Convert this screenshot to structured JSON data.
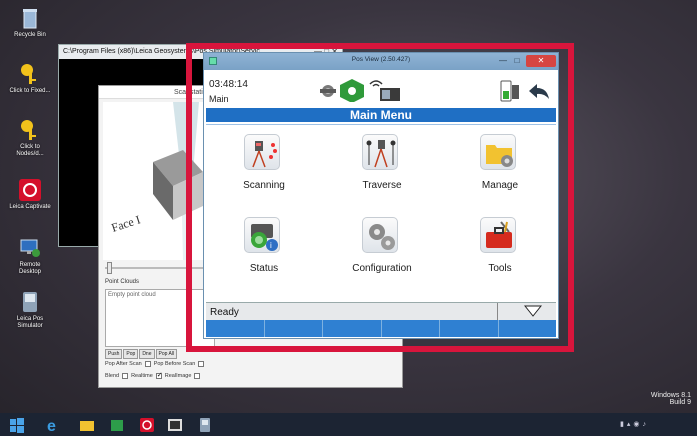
{
  "desktop": {
    "icons": [
      {
        "label": "Recycle Bin"
      },
      {
        "label": "Click to Fixed..."
      },
      {
        "label": "Click to Nodes/d..."
      },
      {
        "label": "Leica Captivate"
      },
      {
        "label": "Remote Desktop"
      },
      {
        "label": "Leica Pos Simulator"
      }
    ],
    "watermark_line1": "Windows 8.1",
    "watermark_line2": "Build 9"
  },
  "console_window": {
    "title": "C:\\Program Files (x86)\\Leica Geosystems\\Pos Simulator\\Servic..."
  },
  "scan_window": {
    "title": "Scanstation",
    "face_label": "Face I",
    "point_clouds_label": "Point Clouds",
    "empty_cloud_text": "Empty point cloud",
    "buttons": [
      "Push",
      "Pop",
      "Dne",
      "Pop All"
    ],
    "options_row1": {
      "pop_after_scan": "Pop After Scan",
      "pop_before_scan": "Pop Before Scan"
    },
    "options_row2": {
      "blend": "Blend",
      "realtime": "Realtime",
      "realimage": "RealImage"
    }
  },
  "pos_view": {
    "window_title": "Pos View (2.50.427)",
    "time": "03:48:14",
    "mode": "Main",
    "menu_title": "Main Menu",
    "tiles": [
      {
        "label": "Scanning"
      },
      {
        "label": "Traverse"
      },
      {
        "label": "Manage"
      },
      {
        "label": "Status"
      },
      {
        "label": "Configuration"
      },
      {
        "label": "Tools"
      }
    ],
    "status_text": "Ready"
  },
  "colors": {
    "highlight": "#d8153c",
    "menu_bar": "#1f6fc4",
    "fkey": "#2f80d2"
  }
}
